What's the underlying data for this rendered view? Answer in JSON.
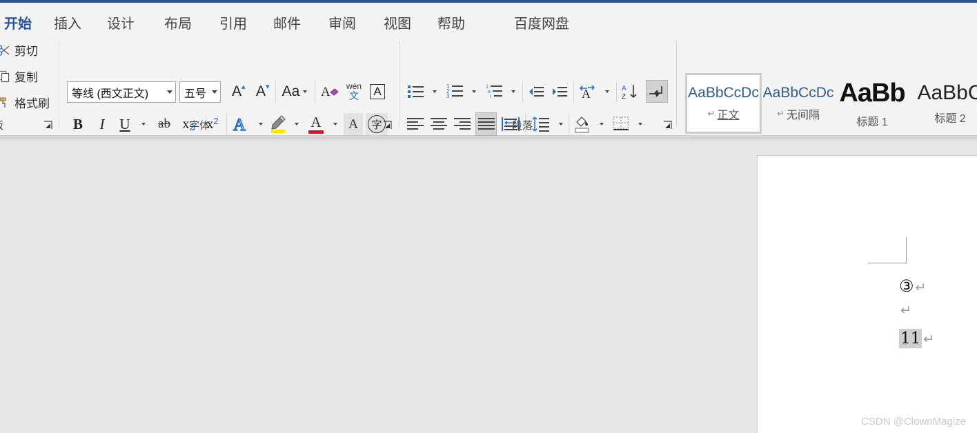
{
  "app": {
    "accent_color": "#2b579a",
    "ribbon_bg": "#f3f3f3",
    "workspace_bg": "#e6e6e6"
  },
  "tabs": [
    {
      "label": "开始",
      "name": "tab-home",
      "active": true
    },
    {
      "label": "插入",
      "name": "tab-insert",
      "active": false
    },
    {
      "label": "设计",
      "name": "tab-design",
      "active": false
    },
    {
      "label": "布局",
      "name": "tab-layout",
      "active": false
    },
    {
      "label": "引用",
      "name": "tab-references",
      "active": false
    },
    {
      "label": "邮件",
      "name": "tab-mailings",
      "active": false
    },
    {
      "label": "审阅",
      "name": "tab-review",
      "active": false
    },
    {
      "label": "视图",
      "name": "tab-view",
      "active": false
    },
    {
      "label": "帮助",
      "name": "tab-help",
      "active": false
    },
    {
      "label": "百度网盘",
      "name": "tab-baidu-netdisk",
      "active": false
    }
  ],
  "clipboard": {
    "group_label": "板",
    "items": [
      {
        "label": "剪切",
        "icon": "scissors-icon"
      },
      {
        "label": "复制",
        "icon": "copy-icon"
      },
      {
        "label": "格式刷",
        "icon": "format-painter-icon"
      }
    ]
  },
  "font_group": {
    "label": "字体",
    "font_name": "等线 (西文正文)",
    "font_size": "五号",
    "buttons": {
      "grow_font": "A",
      "shrink_font": "A",
      "change_case": "Aa",
      "clear_formatting": "clear-formatting-icon",
      "phonetic_top": "wén",
      "phonetic_bottom": "文",
      "character_border": "A",
      "bold": "B",
      "italic": "I",
      "underline": "U",
      "strikethrough": "ab",
      "subscript_base": "x",
      "subscript_sup": "2",
      "superscript_base": "x",
      "superscript_sup": "2",
      "text_effects": "A",
      "highlight": "highlighter-icon",
      "font_color": "A",
      "character_shading": "A",
      "enclose_character": "字"
    }
  },
  "paragraph_group": {
    "label": "段落",
    "buttons": {
      "bullets": "bullet-list-icon",
      "numbering": "numbered-list-icon",
      "multilevel": "multilevel-list-icon",
      "decrease_indent": "decrease-indent-icon",
      "increase_indent": "increase-indent-icon",
      "asian_layout": "asian-layout-icon",
      "sort": "sort-az-icon",
      "show_marks": "show-formatting-marks-icon",
      "align_left": "align-left-icon",
      "align_center": "align-center-icon",
      "align_right": "align-right-icon",
      "justify": "justify-icon",
      "distribute": "distribute-icon",
      "line_spacing": "line-spacing-icon",
      "shading": "shading-icon",
      "borders": "borders-icon"
    },
    "active": [
      "show_marks",
      "justify"
    ]
  },
  "styles": [
    {
      "preview": "AaBbCcDc",
      "name": "正文",
      "pilcrow": "↵",
      "selected": true,
      "kind": "body"
    },
    {
      "preview": "AaBbCcDc",
      "name": "无间隔",
      "pilcrow": "↵",
      "selected": false,
      "kind": "body"
    },
    {
      "preview": "AaBb",
      "name": "标题 1",
      "pilcrow": "",
      "selected": false,
      "kind": "h1"
    },
    {
      "preview": "AaBbC",
      "name": "标题 2",
      "pilcrow": "",
      "selected": false,
      "kind": "h2"
    }
  ],
  "document": {
    "lines": [
      {
        "text": "③",
        "mark": "↵",
        "selected": false,
        "circled": true
      },
      {
        "text": "",
        "mark": "↵",
        "selected": false,
        "circled": false
      },
      {
        "text": "11",
        "mark": "↵",
        "selected": true,
        "circled": false
      }
    ]
  },
  "annotation": {
    "color": "#e01f1f",
    "shape": "double-underline-stroke"
  },
  "watermark": {
    "text": "CSDN @ClownMagize"
  }
}
